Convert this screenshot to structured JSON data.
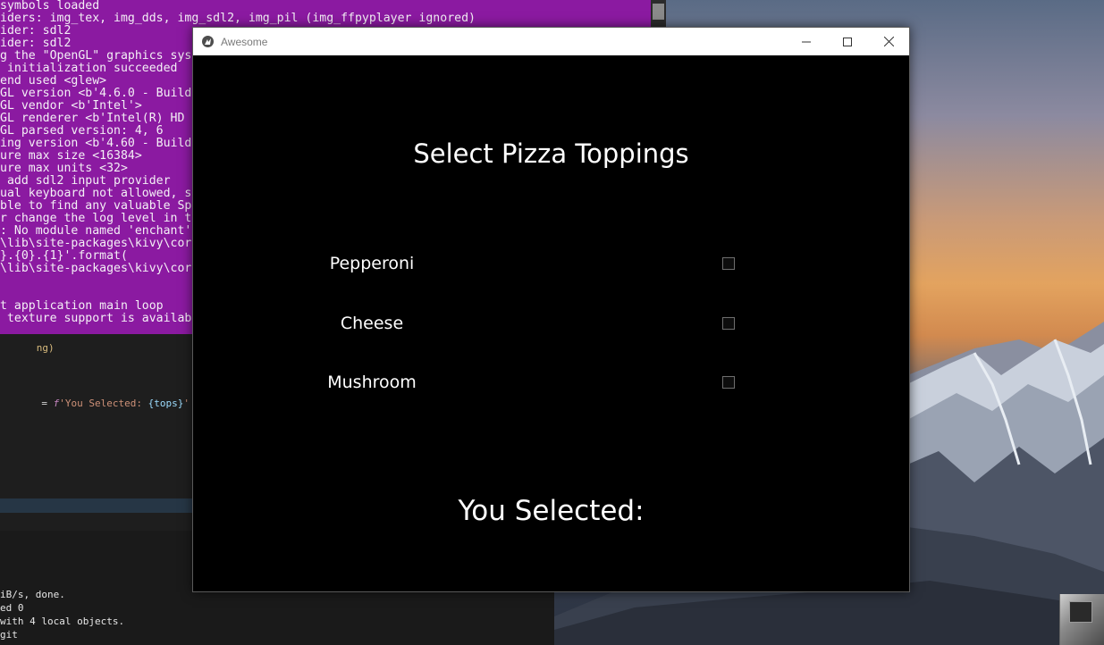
{
  "console": {
    "lines": [
      "symbols loaded",
      "iders: img_tex, img_dds, img_sdl2, img_pil (img_ffpyplayer ignored)",
      "ider: sdl2",
      "ider: sdl2",
      "g the \"OpenGL\" graphics sys",
      " initialization succeeded",
      "end used <glew>",
      "GL version <b'4.6.0 - Build",
      "GL vendor <b'Intel'>",
      "GL renderer <b'Intel(R) HD",
      "GL parsed version: 4, 6",
      "ing version <b'4.60 - Build",
      "ure max size <16384>",
      "ure max units <32>",
      " add sdl2 input provider",
      "ual keyboard not allowed, s",
      "ble to find any valuable Sp",
      "r change the log level in t",
      ": No module named 'enchant'",
      "\\lib\\site-packages\\kivy\\cor",
      "}.{0}.{1}'.format(",
      "\\lib\\site-packages\\kivy\\cor",
      "",
      "",
      "t application main loop",
      " texture support is availab"
    ]
  },
  "editor": {
    "fragment_top": "ng)",
    "code_prefix": " = ",
    "code_fn": "f",
    "code_str_start": "'You Selected: ",
    "code_var": "{tops}",
    "code_str_end": "'"
  },
  "terminal": {
    "lines": [
      "iB/s, done.",
      "ed 0",
      "with 4 local objects.",
      "git"
    ]
  },
  "window": {
    "title": "Awesome",
    "minimize_label": "minimize",
    "maximize_label": "maximize",
    "close_label": "close"
  },
  "app": {
    "heading": "Select Pizza Toppings",
    "toppings": [
      {
        "label": "Pepperoni",
        "checked": false
      },
      {
        "label": "Cheese",
        "checked": false
      },
      {
        "label": "Mushroom",
        "checked": false
      }
    ],
    "result_label": "You Selected:"
  }
}
